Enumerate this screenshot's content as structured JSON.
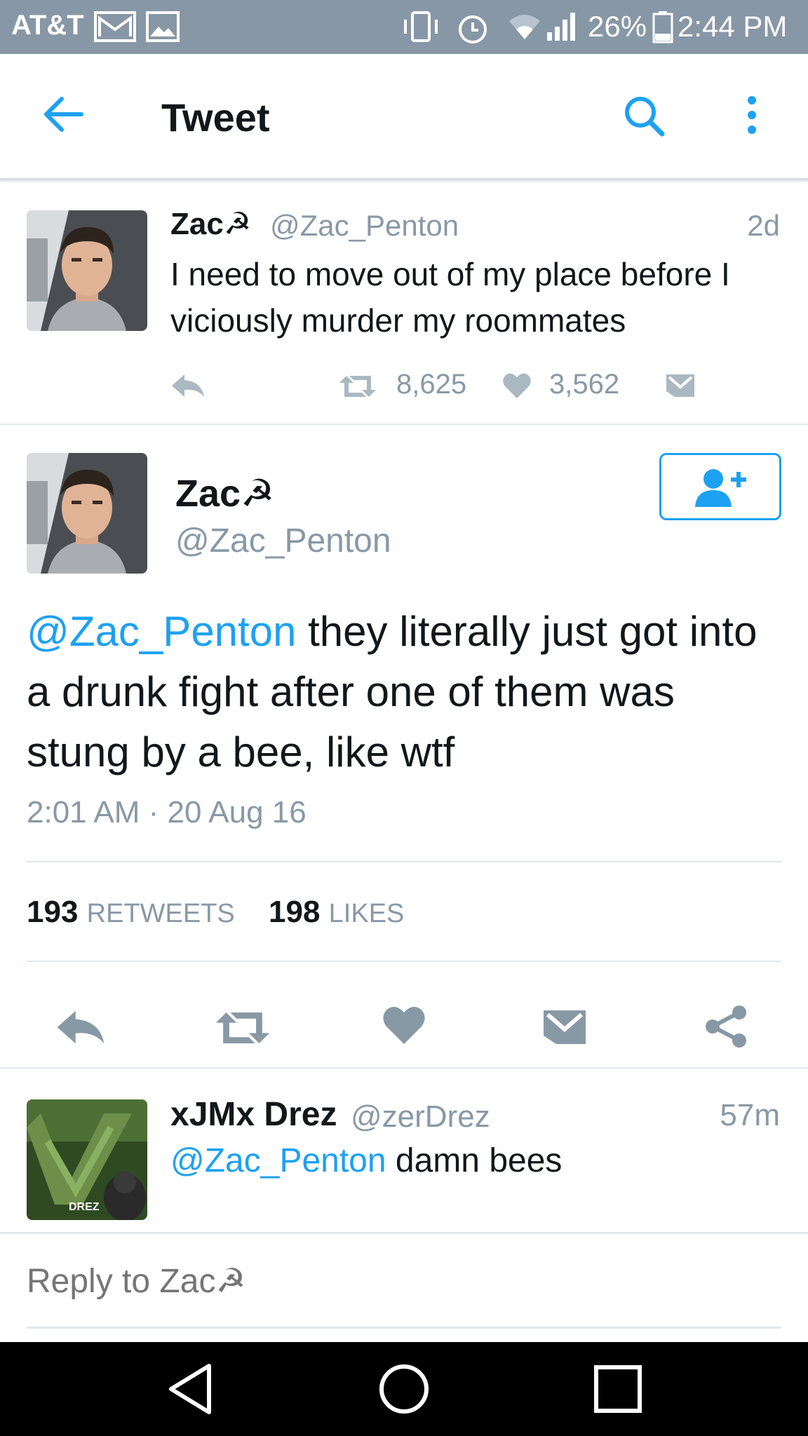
{
  "status_bar": {
    "carrier": "AT&T",
    "battery": "26%",
    "time": "2:44 PM",
    "icons": [
      "gmail-icon",
      "gallery-icon",
      "vibrate-icon",
      "alarm-icon",
      "wifi-icon",
      "signal-icon",
      "battery-icon"
    ]
  },
  "app_bar": {
    "title": "Tweet",
    "icons": [
      "back-arrow-icon",
      "search-icon",
      "more-vertical-icon"
    ]
  },
  "tweet_1": {
    "name": "Zac☭",
    "handle": "@Zac_Penton",
    "time": "2d",
    "text": "I need to move out of my place before I viciously murder my roommates",
    "retweets": "8,625",
    "likes": "3,562"
  },
  "main_tweet": {
    "name": "Zac☭",
    "handle": "@Zac_Penton",
    "mention": "@Zac_Penton",
    "text": " they literally just got into a drunk fight after one of them was stung by a bee, like wtf",
    "timestamp": "2:01 AM · 20 Aug 16",
    "retweet_count": "193",
    "retweet_label": "RETWEETS",
    "like_count": "198",
    "like_label": "LIKES"
  },
  "reply_tweet": {
    "name": "xJMx Drez",
    "handle": "@zerDrez",
    "time": "57m",
    "mention": "@Zac_Penton",
    "text": " damn bees",
    "avatar_text": "DREZ"
  },
  "compose": {
    "placeholder": "Reply to Zac☭"
  },
  "colors": {
    "accent": "#1da1f2",
    "muted": "#8899a6",
    "status_bar": "#8797a6",
    "text": "#14171a"
  }
}
